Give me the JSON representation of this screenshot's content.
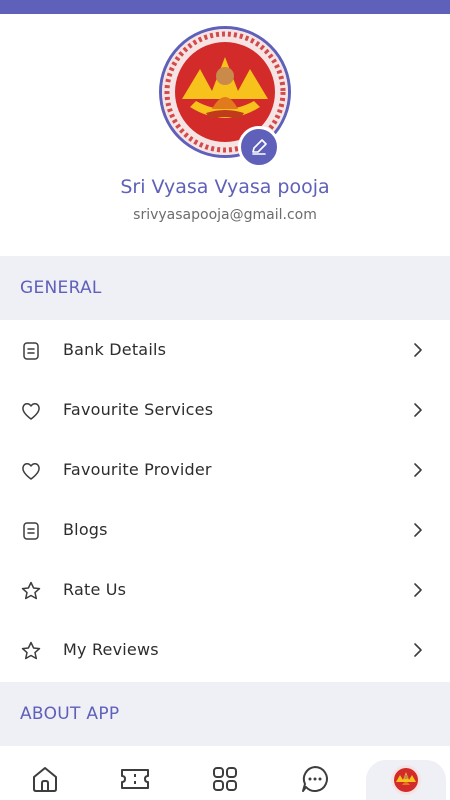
{
  "colors": {
    "accent": "#5f60b9",
    "section_bg": "#efeff6",
    "text": "#2d2d2d",
    "muted": "#6c6c6c"
  },
  "profile": {
    "name": "Sri Vyasa Vyasa pooja",
    "email": "srivyasapooja@gmail.com",
    "edit_icon": "pencil-icon"
  },
  "sections": {
    "general": "GENERAL",
    "about": "ABOUT APP"
  },
  "menu": [
    {
      "label": "Bank Details",
      "icon": "document-icon"
    },
    {
      "label": "Favourite Services",
      "icon": "heart-icon"
    },
    {
      "label": "Favourite Provider",
      "icon": "heart-icon"
    },
    {
      "label": "Blogs",
      "icon": "document-icon"
    },
    {
      "label": "Rate Us",
      "icon": "star-icon"
    },
    {
      "label": "My Reviews",
      "icon": "star-icon"
    }
  ],
  "bottom_nav": [
    {
      "icon": "home-icon"
    },
    {
      "icon": "ticket-icon"
    },
    {
      "icon": "grid-icon"
    },
    {
      "icon": "chat-icon"
    },
    {
      "icon": "profile-avatar",
      "active": true
    }
  ]
}
